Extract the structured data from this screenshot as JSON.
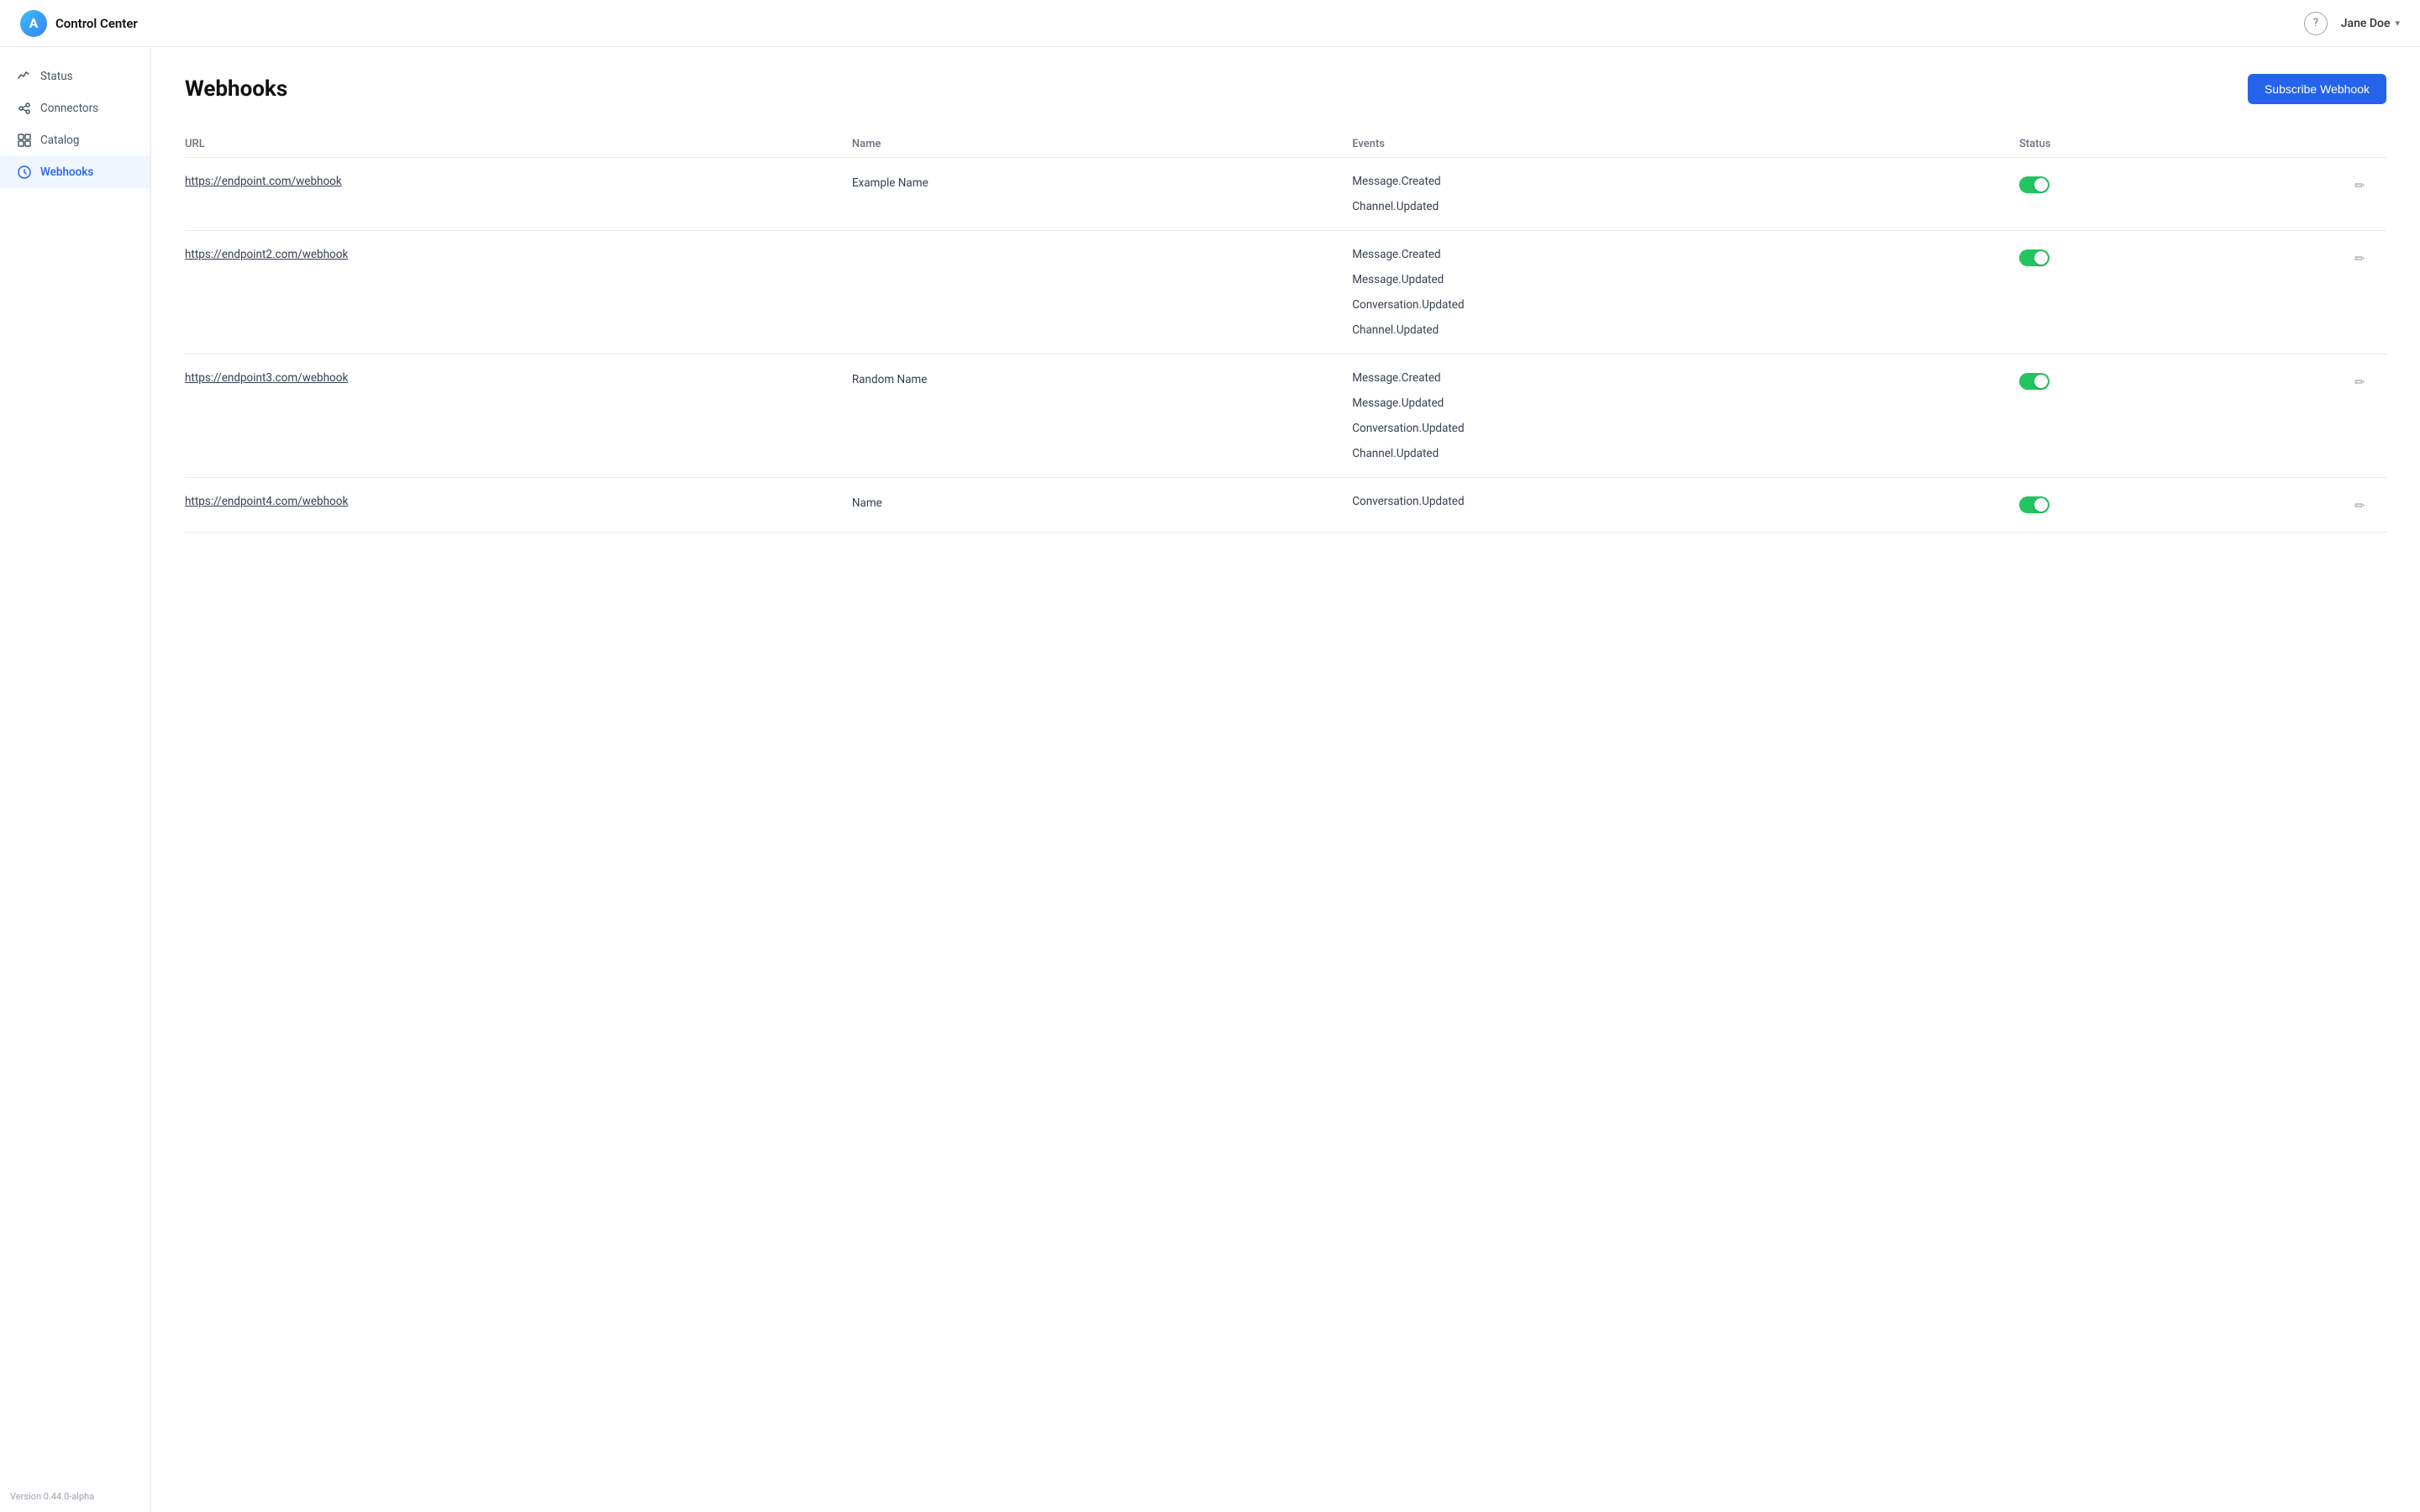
{
  "app": {
    "title": "Control Center",
    "version": "Version 0.44.0-alpha"
  },
  "header": {
    "title": "Control Center",
    "help_label": "?",
    "user_name": "Jane Doe"
  },
  "sidebar": {
    "items": [
      {
        "id": "status",
        "label": "Status",
        "active": false
      },
      {
        "id": "connectors",
        "label": "Connectors",
        "active": false
      },
      {
        "id": "catalog",
        "label": "Catalog",
        "active": false
      },
      {
        "id": "webhooks",
        "label": "Webhooks",
        "active": true
      }
    ]
  },
  "page": {
    "title": "Webhooks",
    "subscribe_btn": "Subscribe Webhook"
  },
  "table": {
    "columns": {
      "url": "URL",
      "name": "Name",
      "events": "Events",
      "status": "Status"
    },
    "rows": [
      {
        "url": "https://endpoint.com/webhook",
        "name": "Example Name",
        "events": [
          "Message.Created",
          "Channel.Updated"
        ],
        "status_active": true
      },
      {
        "url": "https://endpoint2.com/webhook",
        "name": "",
        "events": [
          "Message.Created",
          "Message.Updated",
          "Conversation.Updated",
          "Channel.Updated"
        ],
        "status_active": true
      },
      {
        "url": "https://endpoint3.com/webhook",
        "name": "Random Name",
        "events": [
          "Message.Created",
          "Message.Updated",
          "Conversation.Updated",
          "Channel.Updated"
        ],
        "status_active": true
      },
      {
        "url": "https://endpoint4.com/webhook",
        "name": "Name",
        "events": [
          "Conversation.Updated"
        ],
        "status_active": true
      }
    ]
  }
}
